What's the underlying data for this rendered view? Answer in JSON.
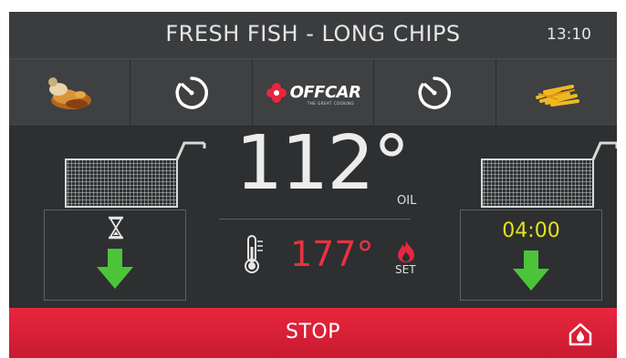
{
  "header": {
    "title": "FRESH FISH - LONG CHIPS",
    "clock": "13:10"
  },
  "toolbar": {
    "items": [
      {
        "name": "fish-program-icon"
      },
      {
        "name": "timer-icon"
      },
      {
        "name": "offcar-logo",
        "brand": "OFFCAR",
        "tagline": "THE GREAT COOKING"
      },
      {
        "name": "timer-icon"
      },
      {
        "name": "chips-program-icon"
      }
    ]
  },
  "temperature": {
    "current": "112°",
    "current_label": "OIL",
    "set": "177°",
    "set_label": "SET"
  },
  "baskets": {
    "left": {
      "status_icon": "hourglass-icon",
      "action_icon": "arrow-down-icon"
    },
    "right": {
      "timer": "04:00",
      "action_icon": "arrow-down-icon"
    }
  },
  "footer": {
    "stop_label": "STOP",
    "home_icon": "home-flame-icon"
  },
  "colors": {
    "background": "#2d2f31",
    "stop": "#e8263d",
    "set_temp": "#e8333f",
    "timer": "#e3e31a",
    "arrow": "#4cc43a"
  }
}
